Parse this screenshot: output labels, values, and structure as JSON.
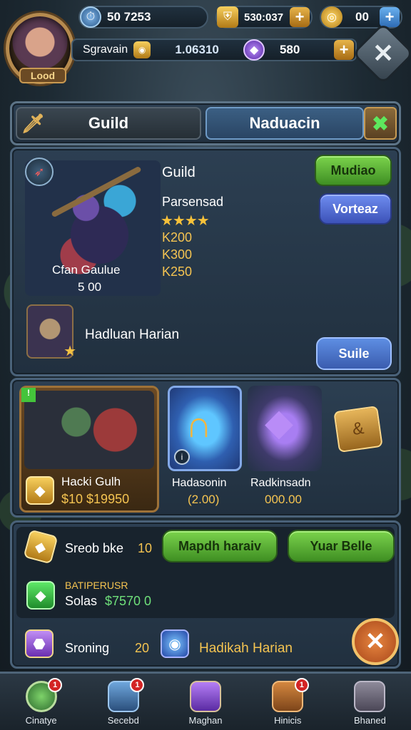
{
  "top_bar": {
    "avatar_label": "Lood",
    "resources": [
      {
        "icon": "time-clock-icon",
        "value": "50 7253"
      },
      {
        "icon": "gold-shield-icon",
        "value": "530:037"
      },
      {
        "icon": "gold-coin-icon",
        "value": "00"
      }
    ],
    "second_row": {
      "name": "Sgravain",
      "coin_value": "1.06310",
      "gem_value": "580"
    }
  },
  "tabs": {
    "left": "Guild",
    "right": "Naduacin"
  },
  "hero_panel": {
    "title": "Guild",
    "subtitle": "Parsensad",
    "stars": "★★★★",
    "stats": [
      "K200",
      "K300",
      "K250"
    ],
    "hero_name": "Cfan Gaulue",
    "hero_power": "5 00",
    "commander_name": "Hadluan Harian",
    "buttons": {
      "top": "Mudiao",
      "middle": "Vorteaz",
      "bottom": "Suile"
    }
  },
  "shop_panel": {
    "featured": {
      "label": "Hacki Gulh",
      "price": "$10 $19950"
    },
    "items": [
      {
        "label": "Hadasonin",
        "price": "(2.00)"
      },
      {
        "label": "Radkinsadn",
        "price": "000.00"
      }
    ]
  },
  "bottom_panel": {
    "row1": {
      "label": "Sreob bke",
      "value": "10",
      "btn1": "Mapdh haraiv",
      "btn2": "Yuar Belle"
    },
    "row2": {
      "title": "BATIPERUSR",
      "label": "Solas",
      "value": "$7570 0"
    },
    "row3": {
      "label": "Sroning",
      "value": "20",
      "name": "Hadikah Harian"
    }
  },
  "nav": [
    {
      "label": "Cinatye",
      "badge": "1",
      "icon": "compass-icon"
    },
    {
      "label": "Secebd",
      "badge": "1",
      "icon": "chest-icon"
    },
    {
      "label": "Maghan",
      "badge": "",
      "icon": "crystal-icon"
    },
    {
      "label": "Hinicis",
      "badge": "1",
      "icon": "crate-icon"
    },
    {
      "label": "Bhaned",
      "badge": "",
      "icon": "backpack-icon"
    }
  ],
  "colors": {
    "green_button": "#5fb33a",
    "blue_button": "#4f6bd4",
    "gold": "#f5c451",
    "panel": "#2c3f52"
  }
}
